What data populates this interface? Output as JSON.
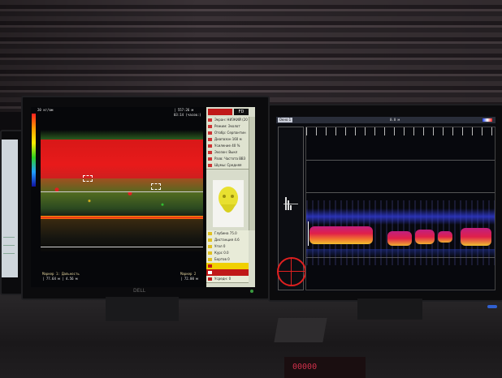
{
  "left_monitor": {
    "scale_label": "20 кг/вм",
    "header_right_1": "| 557:26 м",
    "header_right_2": "03:14 (часов:)",
    "logo_text": "FD",
    "menu_items": [
      "Экран: НИЗКИЙ (20 м)",
      "Режим: Эхолот",
      "Отобр: Серпантин",
      "Диапазон 160 м",
      "Усиление 40 %",
      "Эхозон: Выкл",
      "Разв: Частота ВВЗ",
      "Шумы: Средняя"
    ],
    "lower_items": [
      "Глубина 75.0",
      "Дистанция 4.6",
      "Угол 0",
      "Курс 0.0",
      "Бортов 0",
      "",
      "",
      "Усредн: 0"
    ],
    "bottom_left_1": "Маркер 1: Дальность",
    "bottom_left_2": "| 77.64 м | 4.56 м",
    "bottom_right_1": "Маркер 2",
    "bottom_right_2": "| 72.00 м",
    "brand": "DELL"
  },
  "right_monitor": {
    "tab_label": "Окно 1",
    "top_range": "0.0 м",
    "colors": {
      "hot": "#e0204a",
      "warm": "#f0a020",
      "cool": "#3a4adf"
    }
  },
  "keyboard_display": "00000"
}
